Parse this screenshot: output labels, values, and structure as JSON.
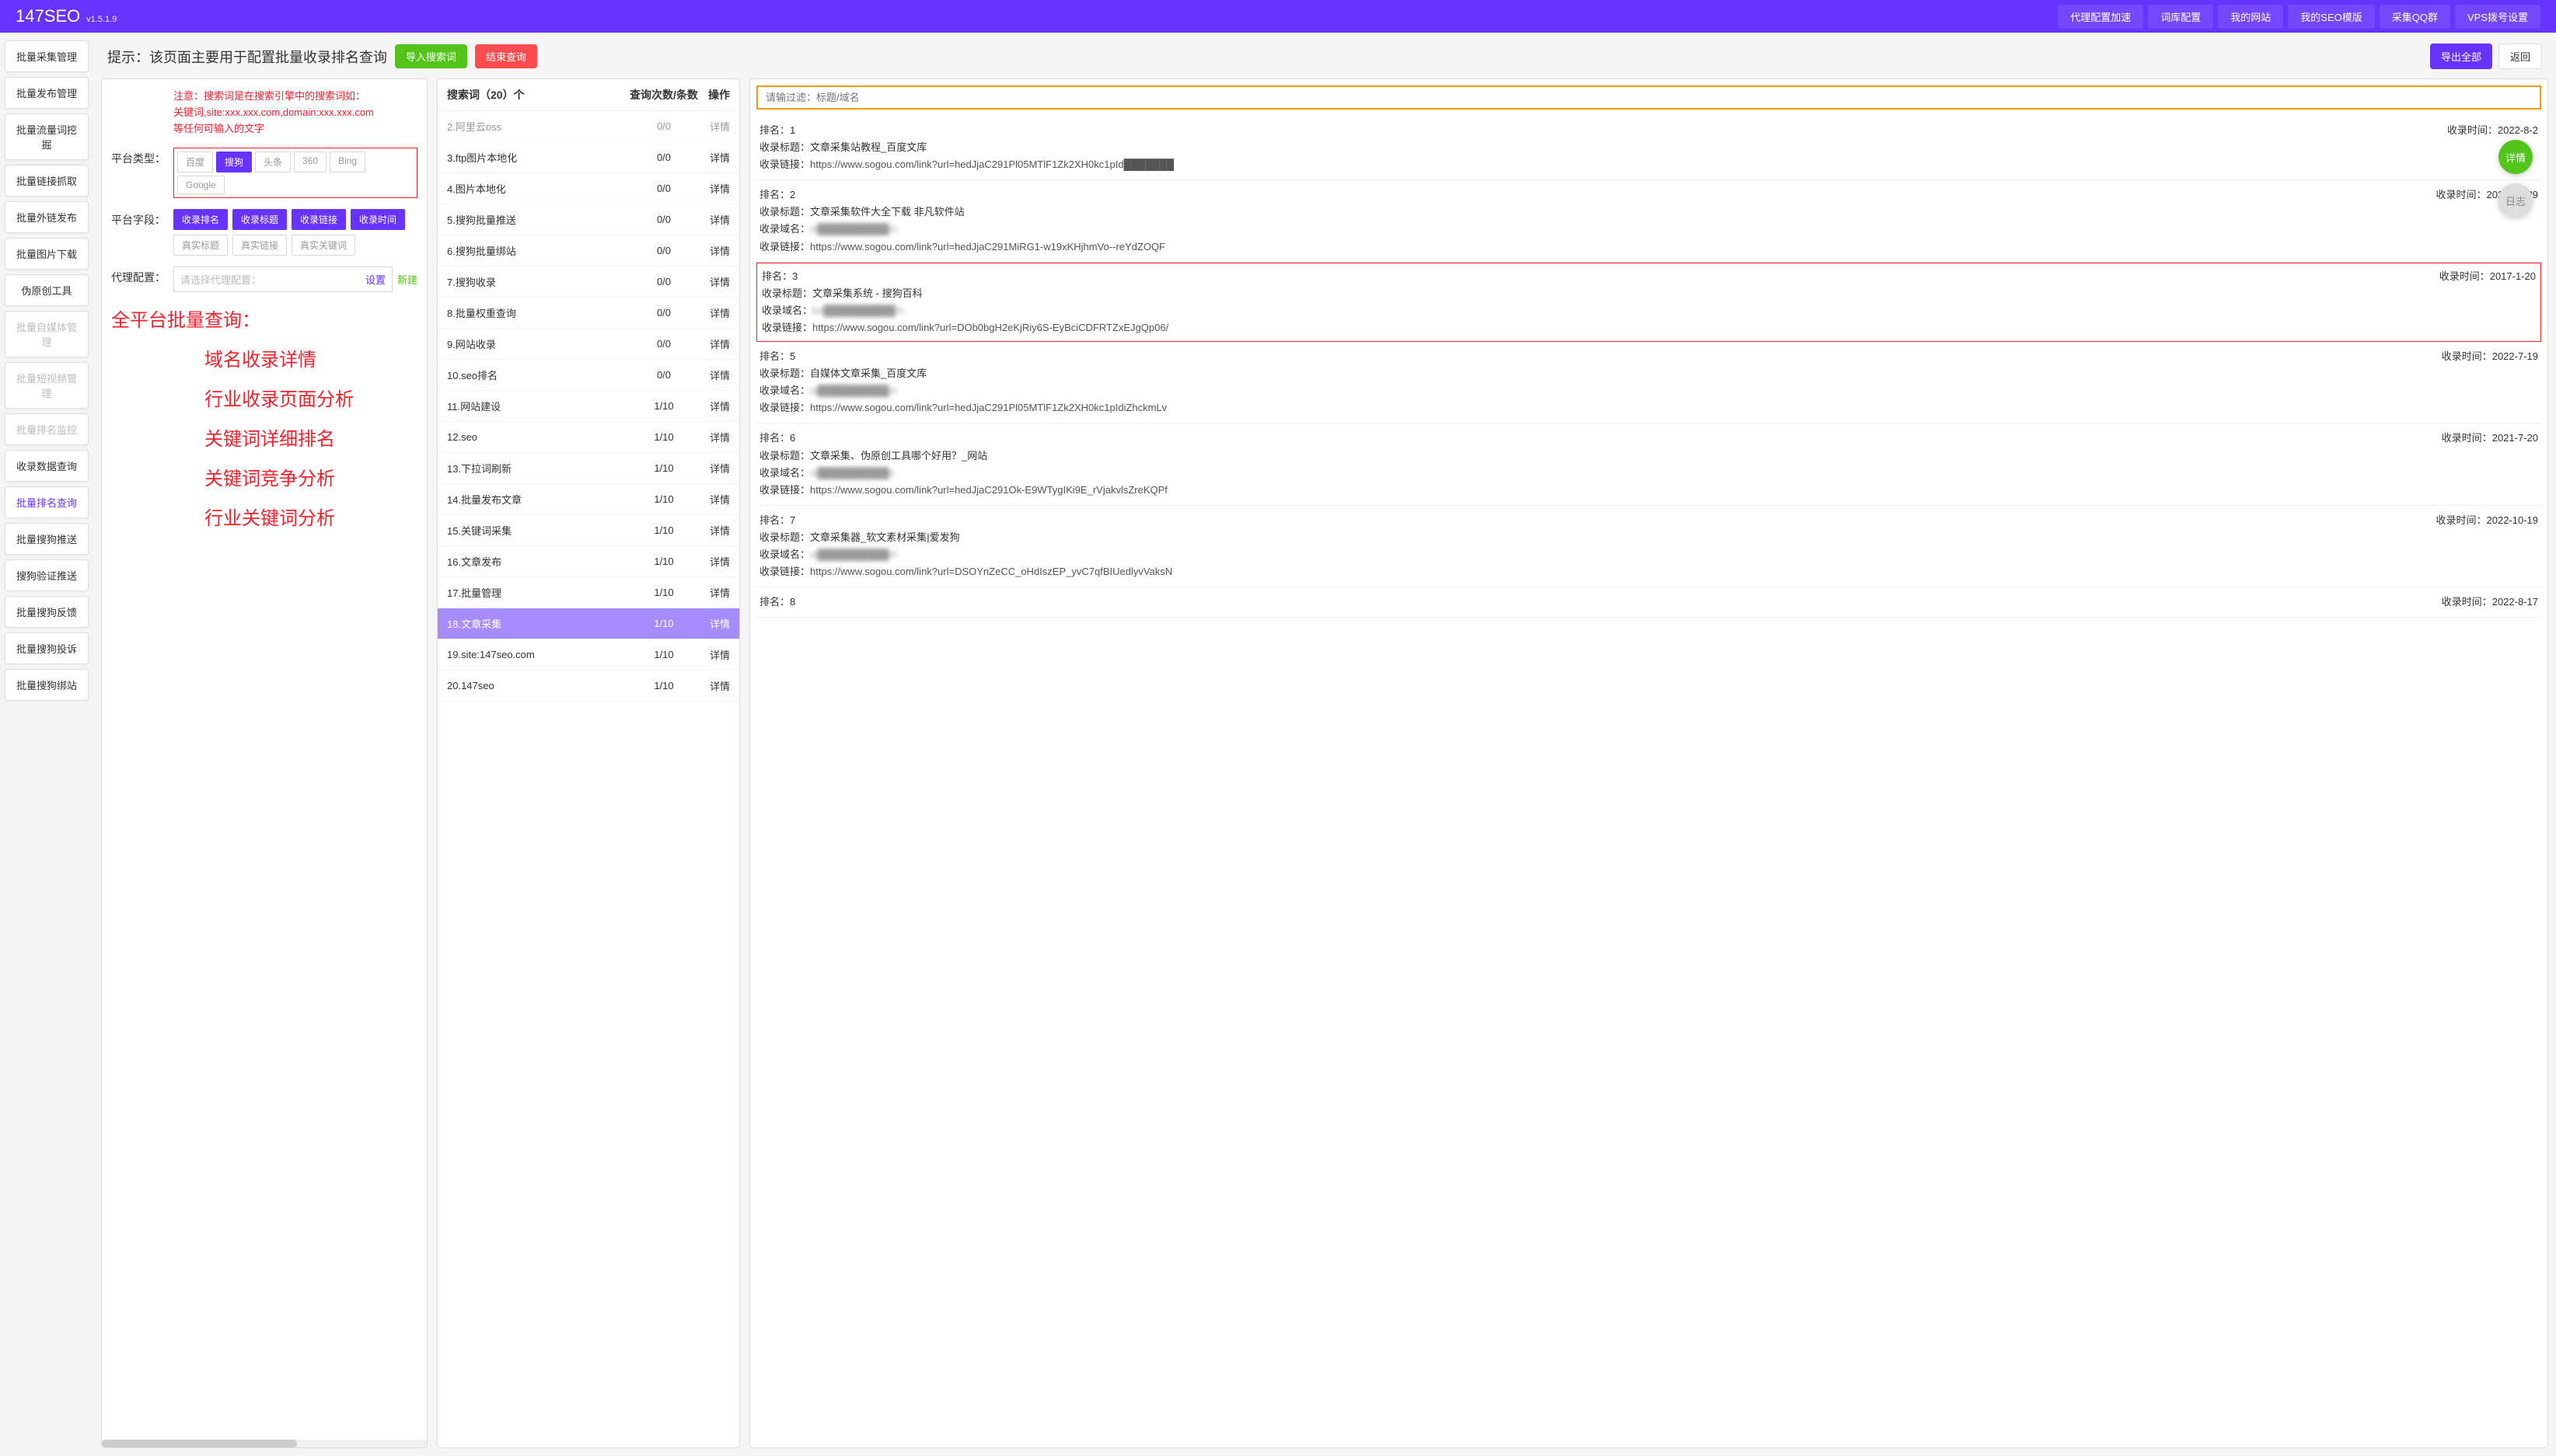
{
  "header": {
    "title": "147SEO",
    "version": "v1.5.1.9",
    "nav": [
      "代理配置加速",
      "词库配置",
      "我的网站",
      "我的SEO模版",
      "采集QQ群",
      "VPS拨号设置"
    ]
  },
  "sidebar": {
    "items": [
      {
        "label": "批量采集管理",
        "state": ""
      },
      {
        "label": "批量发布管理",
        "state": ""
      },
      {
        "label": "批量流量词挖掘",
        "state": ""
      },
      {
        "label": "批量链接抓取",
        "state": ""
      },
      {
        "label": "批量外链发布",
        "state": ""
      },
      {
        "label": "批量图片下载",
        "state": ""
      },
      {
        "label": "伪原创工具",
        "state": ""
      },
      {
        "label": "批量自媒体管理",
        "state": "disabled"
      },
      {
        "label": "批量短视频管理",
        "state": "disabled"
      },
      {
        "label": "批量排名监控",
        "state": "disabled"
      },
      {
        "label": "收录数据查询",
        "state": ""
      },
      {
        "label": "批量排名查询",
        "state": "active"
      },
      {
        "label": "批量搜狗推送",
        "state": ""
      },
      {
        "label": "搜狗验证推送",
        "state": ""
      },
      {
        "label": "批量搜狗反馈",
        "state": ""
      },
      {
        "label": "批量搜狗投诉",
        "state": ""
      },
      {
        "label": "批量搜狗绑站",
        "state": ""
      }
    ]
  },
  "topbar": {
    "tip": "提示：该页面主要用于配置批量收录排名查询",
    "import_btn": "导入搜索词",
    "end_btn": "结束查询",
    "export_btn": "导出全部",
    "back_btn": "返回"
  },
  "config": {
    "warn_line1": "注意：搜索词是在搜索引擎中的搜索词如：",
    "warn_line2": "关键词,site:xxx.xxx.com,domain:xxx.xxx.com",
    "warn_line3": "等任何可输入的文字",
    "platform_label": "平台类型：",
    "platforms": [
      {
        "name": "百度",
        "active": false
      },
      {
        "name": "搜狗",
        "active": true
      },
      {
        "name": "头条",
        "active": false
      },
      {
        "name": "360",
        "active": false
      },
      {
        "name": "Bing",
        "active": false
      },
      {
        "name": "Google",
        "active": false
      }
    ],
    "field_label": "平台字段：",
    "fields_row1": [
      {
        "name": "收录排名",
        "active": true
      },
      {
        "name": "收录标题",
        "active": true
      },
      {
        "name": "收录链接",
        "active": true
      },
      {
        "name": "收录时间",
        "active": true
      }
    ],
    "fields_row2": [
      {
        "name": "真实标题",
        "active": false
      },
      {
        "name": "真实链接",
        "active": false
      },
      {
        "name": "真实关键词",
        "active": false
      }
    ],
    "proxy_label": "代理配置：",
    "proxy_placeholder": "请选择代理配置：",
    "proxy_set": "设置",
    "proxy_new": "新建",
    "headline": "全平台批量查询：",
    "features": [
      "域名收录详情",
      "行业收录页面分析",
      "关键词详细排名",
      "关键词竞争分析",
      "行业关键词分析"
    ]
  },
  "keywords": {
    "header_name": "搜索词（20）个",
    "header_count": "查询次数/条数",
    "header_op": "操作",
    "detail_label": "详情",
    "items": [
      {
        "name": "2.阿里云oss",
        "count": "0/0",
        "selected": false,
        "faded": true
      },
      {
        "name": "3.ftp图片本地化",
        "count": "0/0",
        "selected": false
      },
      {
        "name": "4.图片本地化",
        "count": "0/0",
        "selected": false
      },
      {
        "name": "5.搜狗批量推送",
        "count": "0/0",
        "selected": false
      },
      {
        "name": "6.搜狗批量绑站",
        "count": "0/0",
        "selected": false
      },
      {
        "name": "7.搜狗收录",
        "count": "0/0",
        "selected": false
      },
      {
        "name": "8.批量权重查询",
        "count": "0/0",
        "selected": false
      },
      {
        "name": "9.网站收录",
        "count": "0/0",
        "selected": false
      },
      {
        "name": "10.seo排名",
        "count": "0/0",
        "selected": false
      },
      {
        "name": "11.网站建设",
        "count": "1/10",
        "selected": false
      },
      {
        "name": "12.seo",
        "count": "1/10",
        "selected": false
      },
      {
        "name": "13.下拉词刷新",
        "count": "1/10",
        "selected": false
      },
      {
        "name": "14.批量发布文章",
        "count": "1/10",
        "selected": false
      },
      {
        "name": "15.关键词采集",
        "count": "1/10",
        "selected": false
      },
      {
        "name": "16.文章发布",
        "count": "1/10",
        "selected": false
      },
      {
        "name": "17.批量管理",
        "count": "1/10",
        "selected": false
      },
      {
        "name": "18.文章采集",
        "count": "1/10",
        "selected": true
      },
      {
        "name": "19.site:147seo.com",
        "count": "1/10",
        "selected": false
      },
      {
        "name": "20.147seo",
        "count": "1/10",
        "selected": false
      }
    ]
  },
  "results": {
    "filter_placeholder": "请输过滤：标题/域名",
    "labels": {
      "rank": "排名：",
      "time": "收录时间：",
      "title": "收录标题：",
      "domain": "收录域名：",
      "link": "收录链接："
    },
    "items": [
      {
        "rank": "1",
        "time": "2022-8-2",
        "title": "文章采集站教程_百度文库",
        "domain": "",
        "link": "https://www.sogou.com/link?url=hedJjaC291Pl05MTlF1Zk2XH0kc1pId███████",
        "boxed": false
      },
      {
        "rank": "2",
        "time": "2020-12-29",
        "title": "文章采集软件大全下载 非凡软件站",
        "domain": "w██████████m",
        "link": "https://www.sogou.com/link?url=hedJjaC291MiRG1-w19xKHjhmVo--reYdZOQF",
        "boxed": false
      },
      {
        "rank": "3",
        "time": "2017-1-20",
        "title": "文章采集系统 - 搜狗百科",
        "domain": "ba██████████m",
        "link": "https://www.sogou.com/link?url=DOb0bgH2eKjRiy6S-EyBciCDFRTZxEJgQp06/",
        "boxed": true
      },
      {
        "rank": "5",
        "time": "2022-7-19",
        "title": "自媒体文章采集_百度文库",
        "domain": "w██████████m",
        "link": "https://www.sogou.com/link?url=hedJjaC291Pl05MTlF1Zk2XH0kc1pIdiZhckmLv",
        "boxed": false
      },
      {
        "rank": "6",
        "time": "2021-7-20",
        "title": "文章采集、伪原创工具哪个好用？_网站",
        "domain": "w██████████n",
        "link": "https://www.sogou.com/link?url=hedJjaC291Ok-E9WTygIKi9E_rVjakvlsZreKQPf",
        "boxed": false
      },
      {
        "rank": "7",
        "time": "2022-10-19",
        "title": "文章采集器_软文素材采集|爱发狗",
        "domain": "w██████████m",
        "link": "https://www.sogou.com/link?url=DSOYnZeCC_oHdIszEP_yvC7qfBIUedlyvVaksN",
        "boxed": false
      },
      {
        "rank": "8",
        "time": "2022-8-17",
        "title": "",
        "domain": "",
        "link": "",
        "boxed": false,
        "partial": true
      }
    ]
  },
  "float": {
    "detail": "详情",
    "log": "日志"
  }
}
